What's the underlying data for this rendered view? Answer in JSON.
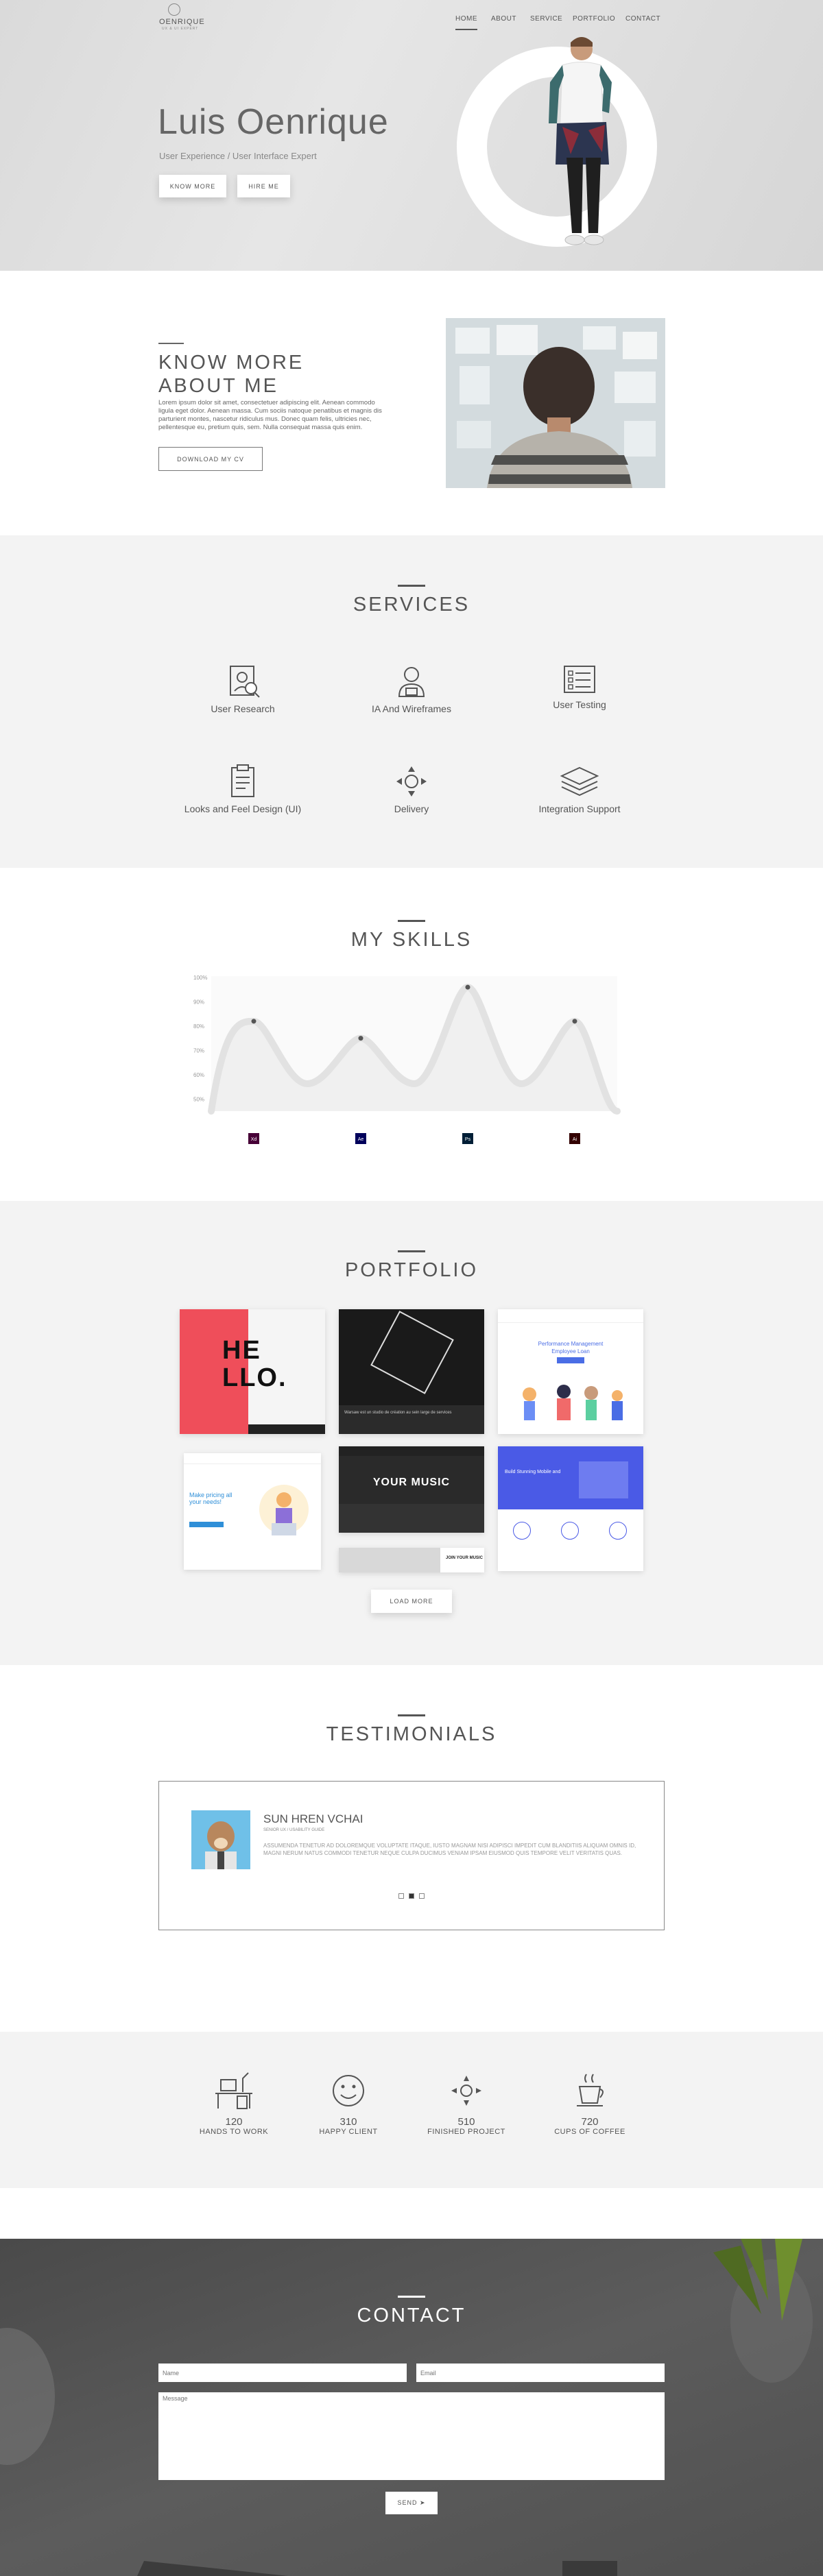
{
  "header": {
    "logo_text": "OENRIQUE",
    "logo_sub": "UX & UI EXPERT",
    "nav": [
      "HOME",
      "ABOUT",
      "SERVICE",
      "PORTFOLIO",
      "CONTACT"
    ]
  },
  "hero": {
    "name": "Luis Oenrique",
    "subtitle": "User Experience / User Interface Expert",
    "know_more": "KNOW MORE",
    "hire_me": "HIRE ME"
  },
  "about": {
    "title_line1": "KNOW MORE",
    "title_line2": "ABOUT ME",
    "text": "Lorem ipsum dolor sit amet, consectetuer adipiscing elit. Aenean commodo ligula eget dolor. Aenean massa. Cum sociis natoque penatibus et magnis dis parturient montes, nascetur ridiculus mus. Donec quam felis, ultricies nec, pellentesque eu, pretium quis, sem. Nulla consequat massa quis enim.",
    "button": "DOWNLOAD MY CV"
  },
  "services": {
    "title": "SERVICES",
    "items": [
      "User Research",
      "IA And Wireframes",
      "User Testing",
      "Looks and Feel Design (UI)",
      "Delivery",
      "Integration Support"
    ]
  },
  "skills": {
    "title": "MY SKILLS"
  },
  "chart_data": {
    "type": "line",
    "categories": [
      "Xd",
      "Ae",
      "Ps",
      "Ai"
    ],
    "values": [
      82,
      75,
      96,
      82
    ],
    "yticks": [
      "50%",
      "60%",
      "70%",
      "80%",
      "90%",
      "100%"
    ],
    "ylim": [
      45,
      100
    ],
    "colors": [
      "#470137",
      "#00005b",
      "#001e36",
      "#330000"
    ]
  },
  "portfolio": {
    "title": "PORTFOLIO",
    "load_more": "LOAD MORE",
    "items": [
      {
        "line1": "HE",
        "line2": "LLO."
      },
      {
        "caption": "Warsaw est un studio de création au sein large de services"
      },
      {
        "heading": "Performance Management",
        "subheading": "Employee Loan"
      },
      {
        "heading": "Make pricing all your needs!"
      },
      {
        "heading": "YOUR MUSIC"
      },
      {
        "heading": "Build Stunning Mobile and"
      },
      {
        "heading": "JOIN YOUR MUSIC"
      }
    ]
  },
  "testimonials": {
    "title": "TESTIMONIALS",
    "name": "SUN HREN VCHAI",
    "role": "SENIOR UX / USABILITY GUIDE",
    "quote": "ASSUMENDA TENETUR AD DOLOREMQUE VOLUPTATE ITAQUE, IUSTO MAGNAM NISI ADIPISCI IMPEDIT CUM BLANDITIIS ALIQUAM OMNIS ID, MAGNI NERUM NATUS COMMODI TENETUR NEQUE CULPA DUCIMUS VENIAM IPSAM EIUSMOD QUIS TEMPORE VELIT VERITATIS QUAS."
  },
  "stats": [
    {
      "value": "120",
      "label": "HANDS TO WORK"
    },
    {
      "value": "310",
      "label": "HAPPY CLIENT"
    },
    {
      "value": "510",
      "label": "FINISHED PROJECT"
    },
    {
      "value": "720",
      "label": "CUPS OF COFFEE"
    }
  ],
  "contact": {
    "title": "CONTACT",
    "name_placeholder": "Name",
    "email_placeholder": "Email",
    "message_placeholder": "Message",
    "send": "SEND"
  }
}
